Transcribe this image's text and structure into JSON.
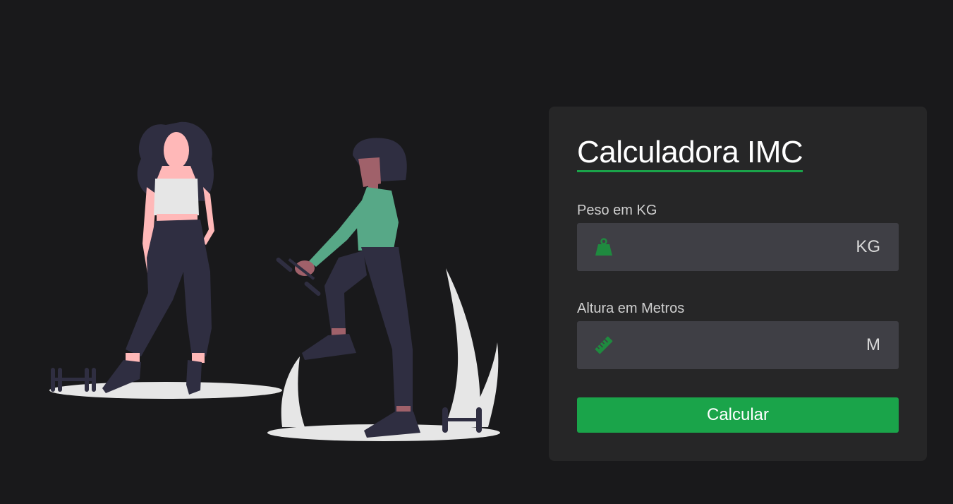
{
  "calculator": {
    "title": "Calculadora IMC",
    "weight": {
      "label": "Peso em KG",
      "value": "",
      "unit": "KG",
      "icon": "weight-icon"
    },
    "height": {
      "label": "Altura em Metros",
      "value": "",
      "unit": "M",
      "icon": "ruler-icon"
    },
    "button_label": "Calcular"
  },
  "colors": {
    "background": "#19191b",
    "card": "#262627",
    "input": "#3f3f45",
    "accent": "#1aa44a",
    "accent_icon": "#1f8a3f"
  }
}
